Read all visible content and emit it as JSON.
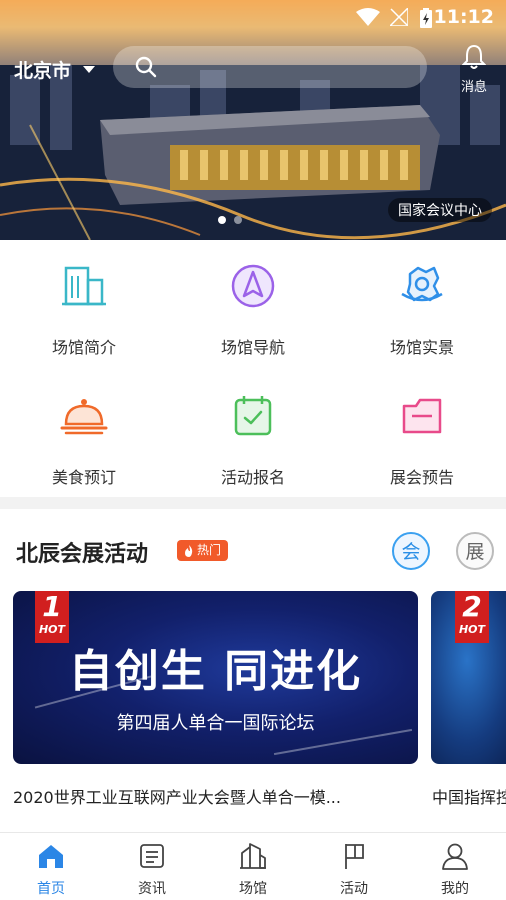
{
  "status_bar": {
    "time": "11:12"
  },
  "header": {
    "city": "北京市",
    "message_label": "消息"
  },
  "banner": {
    "caption": "国家会议中心",
    "slide_count": 2,
    "active_slide": 1
  },
  "grid": {
    "items": [
      {
        "label": "场馆简介",
        "icon": "building-icon",
        "color": "#3ab7c8"
      },
      {
        "label": "场馆导航",
        "icon": "navigation-icon",
        "color": "#9b62e8"
      },
      {
        "label": "场馆实景",
        "icon": "panorama-icon",
        "color": "#2f8fe8"
      },
      {
        "label": "美食预订",
        "icon": "food-cloche-icon",
        "color": "#f06a2a"
      },
      {
        "label": "活动报名",
        "icon": "calendar-check-icon",
        "color": "#4cbf5a"
      },
      {
        "label": "展会预告",
        "icon": "folder-icon",
        "color": "#e84a8a"
      }
    ]
  },
  "section": {
    "title": "北辰会展活动",
    "hot_label": "热门",
    "tabs": [
      {
        "label": "会",
        "active": true
      },
      {
        "label": "展",
        "active": false
      }
    ]
  },
  "cards": [
    {
      "rank": "1",
      "hot": "HOT",
      "headline": "自创生 同进化",
      "subline": "第四届人单合一国际论坛",
      "title": "2020世界工业互联网产业大会暨人单合一模..."
    },
    {
      "rank": "2",
      "hot": "HOT",
      "title": "中国指挥控"
    }
  ],
  "nav": {
    "items": [
      {
        "label": "首页",
        "icon": "home-icon",
        "active": true
      },
      {
        "label": "资讯",
        "icon": "news-icon",
        "active": false
      },
      {
        "label": "场馆",
        "icon": "venue-icon",
        "active": false
      },
      {
        "label": "活动",
        "icon": "flag-icon",
        "active": false
      },
      {
        "label": "我的",
        "icon": "user-icon",
        "active": false
      }
    ]
  },
  "colors": {
    "accent": "#2b86e6",
    "hot": "#f15a2a",
    "badge": "#d11f1f"
  }
}
